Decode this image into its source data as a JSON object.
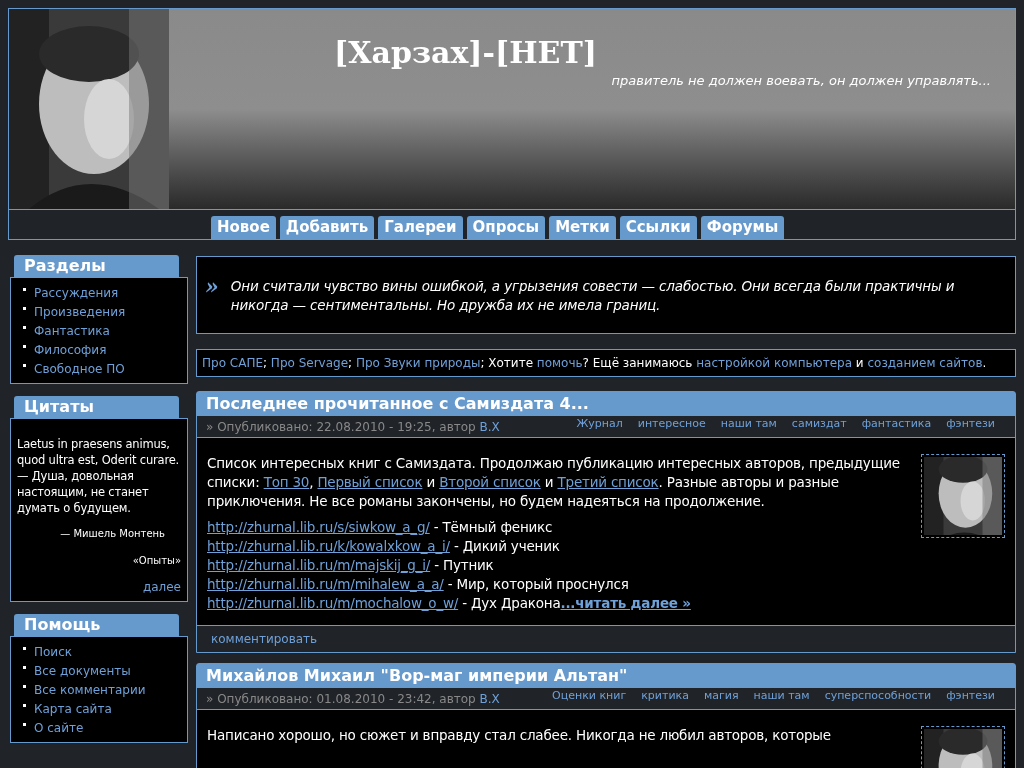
{
  "header": {
    "title": "[Харзах]-[НЕТ]",
    "slogan": "правитель не должен воевать, он должен управлять..."
  },
  "nav": [
    "Новое",
    "Добавить",
    "Галереи",
    "Опросы",
    "Метки",
    "Ссылки",
    "Форумы"
  ],
  "sidebar": [
    {
      "kind": "links",
      "title": "Разделы",
      "items": [
        "Рассуждения",
        "Произведения",
        "Фантастика",
        "Философия",
        "Свободное ПО"
      ]
    },
    {
      "kind": "quote",
      "title": "Цитаты",
      "text": "Laetus in praesens animus, quod ultra est, Oderit curare. — Душа, довольная настоящим, не станет думать о будущем.",
      "author": "— Мишель Монтень",
      "source": "«Опыты»",
      "more": "далее"
    },
    {
      "kind": "links",
      "title": "Помощь",
      "items": [
        "Поиск",
        "Все документы",
        "Все комментарии",
        "Карта сайта",
        "О сайте"
      ]
    }
  ],
  "epigraph": {
    "mark": "»",
    "text": "Они считали чувство вины ошибкой, а угрызения совести — слабостью. Они всегда были практичны и никогда — сентиментальны. Но дружба их не имела границ."
  },
  "links_bar": [
    {
      "kind": "link",
      "text": "Про САПЕ"
    },
    {
      "kind": "text",
      "text": "; "
    },
    {
      "kind": "link",
      "text": "Про Servage"
    },
    {
      "kind": "text",
      "text": "; "
    },
    {
      "kind": "link",
      "text": "Про Звуки природы"
    },
    {
      "kind": "text",
      "text": "; Хотите "
    },
    {
      "kind": "link",
      "text": "помочь"
    },
    {
      "kind": "text",
      "text": "? Ещё занимаюсь "
    },
    {
      "kind": "link",
      "text": "настройкой компьютера"
    },
    {
      "kind": "text",
      "text": " и "
    },
    {
      "kind": "link",
      "text": "созданием сайтов"
    },
    {
      "kind": "text",
      "text": "."
    }
  ],
  "posts": [
    {
      "title": "Последнее прочитанное с Самиздата 4...",
      "meta": "» Опубликовано: 22.08.2010 - 19:25, автор",
      "author": "B.X",
      "tags": [
        "Журнал",
        "интересное",
        "наши там",
        "самиздат",
        "фантастика",
        "фэнтези"
      ],
      "intro": [
        {
          "kind": "text",
          "text": "Список интересных книг с Самиздата. Продолжаю публикацию интересных авторов, предыдущие списки: "
        },
        {
          "kind": "link",
          "text": "Топ 30"
        },
        {
          "kind": "text",
          "text": ", "
        },
        {
          "kind": "link",
          "text": "Первый список"
        },
        {
          "kind": "text",
          "text": " и "
        },
        {
          "kind": "link",
          "text": "Второй список"
        },
        {
          "kind": "text",
          "text": " и "
        },
        {
          "kind": "link",
          "text": "Третий список"
        },
        {
          "kind": "text",
          "text": ". Разные авторы и разные приключения. Не все романы закончены, но будем надеяться на продолжение."
        }
      ],
      "list": [
        {
          "url": "http://zhurnal.lib.ru/s/siwkow_a_g/",
          "title": "- Тёмный феникс"
        },
        {
          "url": "http://zhurnal.lib.ru/k/kowalxkow_a_i/",
          "title": "- Дикий ученик"
        },
        {
          "url": "http://zhurnal.lib.ru/m/majskij_g_i/",
          "title": "- Путник"
        },
        {
          "url": "http://zhurnal.lib.ru/m/mihalew_a_a/",
          "title": "- Мир, который проснулся"
        },
        {
          "url": "http://zhurnal.lib.ru/m/mochalow_o_w/",
          "title": "- Дух Дракона"
        }
      ],
      "read_more": "...читать далее »",
      "comment": "комментировать"
    },
    {
      "title": "Михайлов Михаил \"Вор-маг империи Альтан\"",
      "meta": "» Опубликовано: 01.08.2010 - 23:42, автор",
      "author": "B.X",
      "tags": [
        "Оценки книг",
        "критика",
        "магия",
        "наши там",
        "суперспособности",
        "фэнтези"
      ],
      "intro": [
        {
          "kind": "text",
          "text": "Написано хорошо, но сюжет и вправду стал слабее. Никогда не любил авторов, которые"
        }
      ]
    }
  ]
}
